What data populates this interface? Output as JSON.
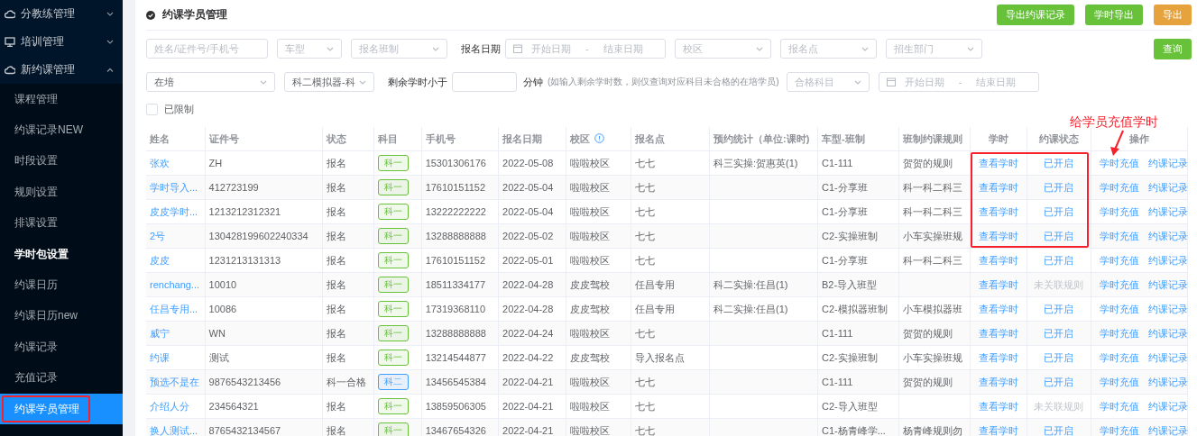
{
  "sidebar": {
    "groups": [
      {
        "label": "分教练管理",
        "expanded": false
      },
      {
        "label": "培训管理",
        "expanded": false
      },
      {
        "label": "新约课管理",
        "expanded": true
      }
    ],
    "items": [
      {
        "label": "课程管理",
        "selected": false,
        "emphasized": false
      },
      {
        "label": "约课记录NEW",
        "selected": false,
        "emphasized": false
      },
      {
        "label": "时段设置",
        "selected": false,
        "emphasized": false
      },
      {
        "label": "规则设置",
        "selected": false,
        "emphasized": false
      },
      {
        "label": "排课设置",
        "selected": false,
        "emphasized": false
      },
      {
        "label": "学时包设置",
        "selected": false,
        "emphasized": true
      },
      {
        "label": "约课日历",
        "selected": false,
        "emphasized": false
      },
      {
        "label": "约课日历new",
        "selected": false,
        "emphasized": false
      },
      {
        "label": "约课记录",
        "selected": false,
        "emphasized": false
      },
      {
        "label": "充值记录",
        "selected": false,
        "emphasized": false
      },
      {
        "label": "约课学员管理",
        "selected": true,
        "emphasized": false
      }
    ]
  },
  "page": {
    "title": "约课学员管理",
    "buttons": [
      {
        "label": "导出约课记录",
        "kind": "green"
      },
      {
        "label": "学时导出",
        "kind": "green"
      },
      {
        "label": "导出",
        "kind": "orange"
      }
    ]
  },
  "filters": {
    "row_1": [
      {
        "kind": "input",
        "placeholder": "姓名/证件号/手机号"
      },
      {
        "kind": "select",
        "placeholder": "车型"
      },
      {
        "kind": "select",
        "placeholder": "报名班制"
      },
      {
        "kind": "label",
        "text": "报名日期"
      },
      {
        "kind": "daterange",
        "start": "开始日期",
        "sep": "-",
        "end": "结束日期"
      },
      {
        "kind": "select",
        "placeholder": "校区"
      },
      {
        "kind": "select",
        "placeholder": "报名点"
      },
      {
        "kind": "select",
        "placeholder": "招生部门"
      }
    ],
    "search_button": "查询",
    "row_2": [
      {
        "kind": "select",
        "value": "在培"
      },
      {
        "kind": "select",
        "value": "科二模拟器-科"
      },
      {
        "kind": "label",
        "text": "剩余学时小于"
      },
      {
        "kind": "input"
      },
      {
        "kind": "label",
        "text": "分钟"
      },
      {
        "kind": "hint",
        "text": "(如输入剩余学时数，则仅查询对应科目未合格的在培学员)"
      },
      {
        "kind": "select",
        "placeholder": "合格科目"
      },
      {
        "kind": "daterange",
        "start": "开始日期",
        "sep": "-",
        "end": "结束日期"
      }
    ],
    "limited": {
      "label": "已限制",
      "checked": false
    }
  },
  "table": {
    "columns": [
      "姓名",
      "证件号",
      "状态",
      "科目",
      "手机号",
      "报名日期",
      "校区",
      "报名点",
      "预约统计（单位:课时)",
      "车型-班制",
      "班制约课规则",
      "学时",
      "约课状态",
      "操作"
    ],
    "rows": [
      {
        "name": "张欢",
        "id_no": "ZH",
        "status": "报名",
        "subject": {
          "text": "科一",
          "color": "#67c23a"
        },
        "phone": "15301306176",
        "date": "2022-05-08",
        "campus": "啦啦校区",
        "point": "七七",
        "stats": "科三实操:贺惠英(1)",
        "class_type": "C1-111",
        "rule": "贺贺的规则",
        "hours": "查看学时",
        "booking": {
          "text": "已开启",
          "linked": true
        },
        "actions": [
          "学时充值",
          "约课记录"
        ]
      },
      {
        "name": "学时导入...",
        "id_no": "412723199",
        "status": "报名",
        "subject": {
          "text": "科一",
          "color": "#67c23a"
        },
        "phone": "17610151152",
        "date": "2022-05-04",
        "campus": "啦啦校区",
        "point": "七七",
        "stats": "",
        "class_type": "C1-分享班",
        "rule": "科一科二科三",
        "hours": "查看学时",
        "booking": {
          "text": "已开启",
          "linked": true
        },
        "actions": [
          "学时充值",
          "约课记录"
        ]
      },
      {
        "name": "皮皮学时...",
        "id_no": "1213212312321",
        "status": "报名",
        "subject": {
          "text": "科一",
          "color": "#67c23a"
        },
        "phone": "13222222222",
        "date": "2022-05-04",
        "campus": "啦啦校区",
        "point": "七七",
        "stats": "",
        "class_type": "C1-分享班",
        "rule": "科一科二科三",
        "hours": "查看学时",
        "booking": {
          "text": "已开启",
          "linked": true
        },
        "actions": [
          "学时充值",
          "约课记录"
        ]
      },
      {
        "name": "2号",
        "id_no": "130428199602240334",
        "status": "报名",
        "subject": {
          "text": "科一",
          "color": "#67c23a"
        },
        "phone": "13288888888",
        "date": "2022-05-02",
        "campus": "啦啦校区",
        "point": "七七",
        "stats": "",
        "class_type": "C2-实操班制",
        "rule": "小车实操班规",
        "hours": "查看学时",
        "booking": {
          "text": "已开启",
          "linked": true
        },
        "actions": [
          "学时充值",
          "约课记录"
        ]
      },
      {
        "name": "皮皮",
        "id_no": "1231213131313",
        "status": "报名",
        "subject": {
          "text": "科一",
          "color": "#67c23a"
        },
        "phone": "17610151152",
        "date": "2022-05-01",
        "campus": "啦啦校区",
        "point": "七七",
        "stats": "",
        "class_type": "C1-分享班",
        "rule": "科一科二科三",
        "hours": "查看学时",
        "booking": {
          "text": "已开启",
          "linked": true
        },
        "actions": [
          "学时充值",
          "约课记录"
        ]
      },
      {
        "name": "renchang...",
        "id_no": "10010",
        "status": "报名",
        "subject": {
          "text": "科一",
          "color": "#67c23a"
        },
        "phone": "18511334177",
        "date": "2022-04-28",
        "campus": "皮皮驾校",
        "point": "任昌专用",
        "stats": "科二实操:任昌(1)",
        "class_type": "B2-导入班型",
        "rule": "",
        "hours": "查看学时",
        "booking": {
          "text": "未关联规则",
          "linked": false
        },
        "actions": [
          "学时充值",
          "约课记录"
        ]
      },
      {
        "name": "任昌专用...",
        "id_no": "10086",
        "status": "报名",
        "subject": {
          "text": "科一",
          "color": "#67c23a"
        },
        "phone": "17319368110",
        "date": "2022-04-28",
        "campus": "皮皮驾校",
        "point": "任昌专用",
        "stats": "科二实操:任昌(1)",
        "class_type": "C2-模拟器班制",
        "rule": "小车模拟器班",
        "hours": "查看学时",
        "booking": {
          "text": "已开启",
          "linked": true
        },
        "actions": [
          "学时充值",
          "约课记录"
        ]
      },
      {
        "name": "威宁",
        "id_no": "WN",
        "status": "报名",
        "subject": {
          "text": "科一",
          "color": "#67c23a"
        },
        "phone": "13288888888",
        "date": "2022-04-24",
        "campus": "啦啦校区",
        "point": "七七",
        "stats": "",
        "class_type": "C1-111",
        "rule": "贺贺的规则",
        "hours": "查看学时",
        "booking": {
          "text": "已开启",
          "linked": true
        },
        "actions": [
          "学时充值",
          "约课记录"
        ]
      },
      {
        "name": "约课",
        "id_no": "测试",
        "status": "报名",
        "subject": {
          "text": "科一",
          "color": "#67c23a"
        },
        "phone": "13214544877",
        "date": "2022-04-22",
        "campus": "皮皮驾校",
        "point": "导入报名点",
        "stats": "",
        "class_type": "C2-实操班制",
        "rule": "小车实操班规",
        "hours": "查看学时",
        "booking": {
          "text": "已开启",
          "linked": true
        },
        "actions": [
          "学时充值",
          "约课记录"
        ]
      },
      {
        "name": "预选不是在",
        "id_no": "9876543213456",
        "status": "科一合格",
        "subject": {
          "text": "科二",
          "color": "#409eff"
        },
        "phone": "13456545384",
        "date": "2022-04-21",
        "campus": "啦啦校区",
        "point": "七七",
        "stats": "",
        "class_type": "C1-111",
        "rule": "贺贺的规则",
        "hours": "查看学时",
        "booking": {
          "text": "已开启",
          "linked": true
        },
        "actions": [
          "学时充值",
          "约课记录"
        ]
      },
      {
        "name": "介绍人分",
        "id_no": "234564321",
        "status": "报名",
        "subject": {
          "text": "科一",
          "color": "#67c23a"
        },
        "phone": "13859506305",
        "date": "2022-04-21",
        "campus": "啦啦校区",
        "point": "七七",
        "stats": "",
        "class_type": "C2-导入班型",
        "rule": "",
        "hours": "查看学时",
        "booking": {
          "text": "未关联规则",
          "linked": false
        },
        "actions": [
          "学时充值",
          "约课记录"
        ]
      },
      {
        "name": "换人测试...",
        "id_no": "8765432134567",
        "status": "报名",
        "subject": {
          "text": "科一",
          "color": "#67c23a"
        },
        "phone": "13467654326",
        "date": "2022-04-21",
        "campus": "啦啦校区",
        "point": "七七",
        "stats": "",
        "class_type": "C1-杨青峰学...",
        "rule": "杨青峰规则勿",
        "hours": "查看学时",
        "booking": {
          "text": "已开启",
          "linked": true
        },
        "actions": [
          "学时充值",
          "约课记录"
        ]
      }
    ]
  },
  "annotation": {
    "text": "给学员充值学时"
  }
}
